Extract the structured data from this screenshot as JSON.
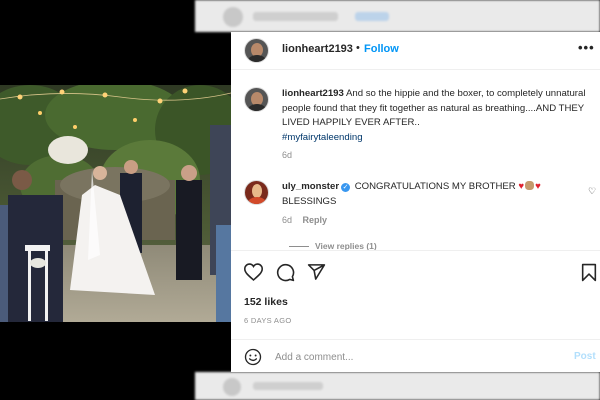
{
  "post": {
    "author": "lionheart2193",
    "follow_label": "Follow",
    "separator": "•",
    "more_label": "•••",
    "caption": {
      "username": "lionheart2193",
      "text": "And so the hippie and the boxer, to completely unnatural people found that they fit together as natural as breathing....AND THEY LIVED HAPPILY EVER AFTER..",
      "hashtag": "#myfairytaleending",
      "time": "6d"
    },
    "comments": [
      {
        "username": "uly_monster",
        "verified_icon": "verified-badge-icon",
        "text": "CONGRATULATIONS MY BROTHER",
        "text_after": "BLESSINGS",
        "time": "6d",
        "reply_label": "Reply",
        "view_replies_label": "View replies (1)"
      }
    ],
    "likes": "152 likes",
    "date": "6 DAYS AGO"
  },
  "composer": {
    "placeholder": "Add a comment...",
    "post_label": "Post"
  },
  "icons": {
    "like": "heart-outline-icon",
    "comment": "comment-bubble-icon",
    "share": "paper-plane-icon",
    "save": "bookmark-icon",
    "emoji": "smiley-icon"
  },
  "colors": {
    "accent": "#0095f6",
    "text": "#262626",
    "muted": "#8e8e8e",
    "post_disabled": "#b2dffc"
  }
}
